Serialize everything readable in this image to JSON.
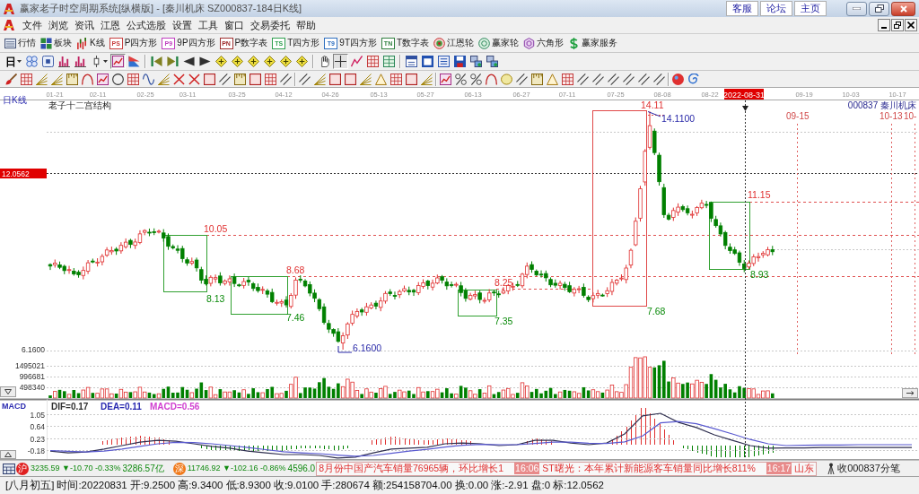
{
  "window": {
    "title": "赢家老子时空周期系统[纵横版] - [秦川机床 SZ000837-184日K线]",
    "links": [
      "客服",
      "论坛",
      "主页"
    ]
  },
  "menu": [
    "文件",
    "浏览",
    "资讯",
    "江恩",
    "公式选股",
    "设置",
    "工具",
    "窗口",
    "交易委托",
    "帮助"
  ],
  "toolbar": [
    {
      "kind": "quote",
      "label": "行情"
    },
    {
      "kind": "sector",
      "label": "板块"
    },
    {
      "kind": "kline",
      "label": "K线"
    },
    {
      "kind": "tile",
      "tile": "PS",
      "color": "#c84040",
      "label": "P四方形"
    },
    {
      "kind": "tile",
      "tile": "P9",
      "color": "#c040c0",
      "label": "9P四方形"
    },
    {
      "kind": "tile",
      "tile": "PN",
      "color": "#a03030",
      "label": "P数字表"
    },
    {
      "kind": "tile",
      "tile": "TS",
      "color": "#30a050",
      "label": "T四方形"
    },
    {
      "kind": "tile",
      "tile": "T9",
      "color": "#3070c0",
      "label": "9T四方形"
    },
    {
      "kind": "tile",
      "tile": "TN",
      "color": "#308040",
      "label": "T数字表"
    },
    {
      "kind": "target",
      "label": "江恩轮"
    },
    {
      "kind": "wheel",
      "label": "赢家轮"
    },
    {
      "kind": "hexagon",
      "label": "六角形"
    },
    {
      "kind": "dollar",
      "label": "赢家服务"
    }
  ],
  "tool_groups": [
    [
      {
        "kind": "period",
        "label": "日",
        "pressed": false
      },
      {
        "kind": "circles",
        "pressed": false
      },
      {
        "kind": "frame",
        "pressed": false
      },
      {
        "kind": "bars",
        "pressed": false
      },
      {
        "kind": "bars",
        "pressed": false
      },
      {
        "kind": "candle",
        "pressed": false
      },
      {
        "kind": "chart",
        "pressed": true
      },
      {
        "kind": "flag",
        "pressed": false
      }
    ],
    [
      {
        "kind": "skip-start",
        "pressed": false
      },
      {
        "kind": "skip-end",
        "pressed": false
      },
      {
        "kind": "left",
        "pressed": false
      },
      {
        "kind": "right",
        "pressed": false
      },
      {
        "kind": "diamond",
        "pressed": false
      },
      {
        "kind": "diamond",
        "pressed": false
      },
      {
        "kind": "diamond",
        "pressed": false
      },
      {
        "kind": "diamond",
        "pressed": false
      },
      {
        "kind": "diamond",
        "pressed": false
      },
      {
        "kind": "diamond",
        "pressed": false
      }
    ],
    [
      {
        "kind": "hand",
        "pressed": false
      },
      {
        "kind": "crosshair",
        "pressed": true
      },
      {
        "kind": "zigzag",
        "pressed": false
      },
      {
        "kind": "grid",
        "pressed": false
      },
      {
        "kind": "table",
        "pressed": false
      }
    ],
    [
      {
        "kind": "calendar",
        "pressed": false
      },
      {
        "kind": "window",
        "pressed": false
      },
      {
        "kind": "list",
        "pressed": false
      },
      {
        "kind": "save",
        "pressed": false
      },
      {
        "kind": "network",
        "pressed": false
      },
      {
        "kind": "network",
        "pressed": false
      }
    ]
  ],
  "drawing_tool_groups": [
    [
      {
        "kind": "brush"
      },
      {
        "kind": "grid"
      },
      {
        "kind": "fan"
      },
      {
        "kind": "fan"
      },
      {
        "kind": "ruler"
      },
      {
        "kind": "arc"
      },
      {
        "kind": "chart"
      },
      {
        "kind": "circle"
      },
      {
        "kind": "grid"
      },
      {
        "kind": "wave"
      },
      {
        "kind": "fan"
      },
      {
        "kind": "cross"
      },
      {
        "kind": "cross"
      },
      {
        "kind": "rect"
      },
      {
        "kind": "parallel"
      },
      {
        "kind": "ruler"
      },
      {
        "kind": "rect"
      },
      {
        "kind": "grid"
      },
      {
        "kind": "parallel"
      }
    ],
    [
      {
        "kind": "parallel"
      },
      {
        "kind": "fan"
      },
      {
        "kind": "rect"
      },
      {
        "kind": "rect"
      },
      {
        "kind": "fan"
      },
      {
        "kind": "triangle"
      },
      {
        "kind": "grid"
      },
      {
        "kind": "rect"
      },
      {
        "kind": "fan"
      }
    ],
    [
      {
        "kind": "chart"
      },
      {
        "kind": "percent"
      },
      {
        "kind": "percent"
      },
      {
        "kind": "arc"
      },
      {
        "kind": "ellipse"
      },
      {
        "kind": "parallel"
      },
      {
        "kind": "ruler"
      },
      {
        "kind": "triangle"
      },
      {
        "kind": "grid"
      },
      {
        "kind": "parallel"
      },
      {
        "kind": "parallel"
      },
      {
        "kind": "parallel"
      },
      {
        "kind": "parallel"
      },
      {
        "kind": "parallel"
      },
      {
        "kind": "parallel"
      }
    ],
    [
      {
        "kind": "ball"
      },
      {
        "kind": "swirl"
      }
    ]
  ],
  "chart": {
    "period": "日K线",
    "dates": [
      {
        "label": "01-21",
        "selected": false
      },
      {
        "label": "02-11",
        "selected": false
      },
      {
        "label": "02-25",
        "selected": false
      },
      {
        "label": "03-11",
        "selected": false
      },
      {
        "label": "03-25",
        "selected": false
      },
      {
        "label": "04-12",
        "selected": false
      },
      {
        "label": "04-26",
        "selected": false
      },
      {
        "label": "05-13",
        "selected": false
      },
      {
        "label": "05-27",
        "selected": false
      },
      {
        "label": "06-13",
        "selected": false
      },
      {
        "label": "06-27",
        "selected": false
      },
      {
        "label": "07-11",
        "selected": false
      },
      {
        "label": "07-25",
        "selected": false
      },
      {
        "label": "08-08",
        "selected": false
      },
      {
        "label": "08-22",
        "selected": false
      },
      {
        "label": "2022-08-31",
        "selected": true
      },
      {
        "label": "09-19",
        "selected": false
      },
      {
        "label": "10-03",
        "selected": false
      },
      {
        "label": "10-17",
        "selected": false
      }
    ],
    "title": "老子十二宫结构",
    "stock": "000837 秦川机床",
    "cursor_price": "12.0562",
    "low_price": "6.1600",
    "marks": [
      {
        "text": "14.11",
        "kind": "resistance"
      },
      {
        "text": "14.1100",
        "kind": "extreme"
      },
      {
        "text": "10.05",
        "kind": "resistance"
      },
      {
        "text": "8.13",
        "kind": "support"
      },
      {
        "text": "8.68",
        "kind": "resistance"
      },
      {
        "text": "7.46",
        "kind": "support"
      },
      {
        "text": "6.1600",
        "kind": "extreme"
      },
      {
        "text": "8.25",
        "kind": "resistance"
      },
      {
        "text": "7.35",
        "kind": "support"
      },
      {
        "text": "7.68",
        "kind": "support"
      },
      {
        "text": "11.15",
        "kind": "resistance"
      },
      {
        "text": "8.93",
        "kind": "support"
      }
    ],
    "date_marks": [
      "09-15",
      "10-13",
      "10-"
    ]
  },
  "volume": {
    "ticks": [
      "1495021",
      "996681",
      "498340"
    ]
  },
  "macd": {
    "name": "MACD",
    "readings": [
      {
        "text": "DIF=0.17",
        "color": "#303030"
      },
      {
        "text": "DEA=0.11",
        "color": "#2a2ab0"
      },
      {
        "text": "MACD=0.56",
        "color": "#d040d0"
      }
    ],
    "chart_data": {
      "type": "line",
      "ylim": [
        -0.51,
        1.56
      ],
      "yticks": [
        1.05,
        0.64,
        0.23,
        -0.18
      ],
      "grid": true,
      "series": [
        {
          "color": "#303050",
          "values": [
            -0.22,
            -0.28,
            -0.25,
            -0.15,
            -0.03,
            0.09,
            0.15,
            0.12,
            0.03,
            -0.06,
            -0.12,
            -0.22,
            -0.28,
            -0.34,
            -0.34,
            -0.37,
            -0.46,
            -0.43,
            -0.28,
            -0.15,
            -0.12,
            -0.09,
            0.03,
            0.06,
            0.03,
            -0.03,
            0.0,
            0.15,
            0.15,
            0.06,
            0.0,
            0.06,
            0.37,
            0.99,
            1.08,
            0.77,
            0.59,
            0.34,
            0.15,
            -0.03,
            -0.12,
            -0.11,
            -0.11,
            -0.1,
            -0.1,
            -0.1,
            -0.1,
            -0.1,
            -0.1
          ]
        },
        {
          "color": "#5a5ad0",
          "values": [
            -0.2,
            -0.23,
            -0.25,
            -0.22,
            -0.15,
            -0.06,
            0.03,
            0.08,
            0.07,
            0.03,
            -0.03,
            -0.1,
            -0.17,
            -0.24,
            -0.28,
            -0.31,
            -0.36,
            -0.4,
            -0.37,
            -0.3,
            -0.22,
            -0.16,
            -0.08,
            -0.02,
            0.01,
            0.0,
            0.0,
            0.04,
            0.09,
            0.09,
            0.05,
            0.04,
            0.1,
            0.3,
            0.75,
            0.8,
            0.72,
            0.55,
            0.37,
            0.18,
            0.03,
            -0.03,
            -0.02,
            -0.01,
            -0.01,
            0.0,
            0.0,
            0.0,
            0.0
          ]
        }
      ]
    }
  },
  "ticker": {
    "indices": [
      {
        "badge": "沪",
        "color": "#e02020",
        "value": "3235.59",
        "change": "▼-10.70",
        "percent": "-0.33%",
        "turnover": "3286.57亿"
      },
      {
        "badge": "深",
        "color": "#f07818",
        "value": "11746.92",
        "change": "▼-102.16",
        "percent": "-0.86%",
        "turnover": "4596.0"
      }
    ],
    "news": [
      {
        "text": "8月份中国产汽车销量76965辆，环比增长1"
      },
      {
        "time": "16:06",
        "text": "ST曙光：本年累计新能源客车销量同比增长811%"
      },
      {
        "time": "16:17",
        "text": "山东"
      }
    ],
    "tick_link": "收000837分笔"
  },
  "status_bar": [
    "[八月初五]",
    "时间:20220831",
    "开:9.2500",
    "高:9.3400",
    "低:8.9300",
    "收:9.0100",
    "手:280674",
    "额:254158704.00",
    "换:0.00",
    "涨:-2.91",
    "盘:0",
    "标:12.0562"
  ]
}
